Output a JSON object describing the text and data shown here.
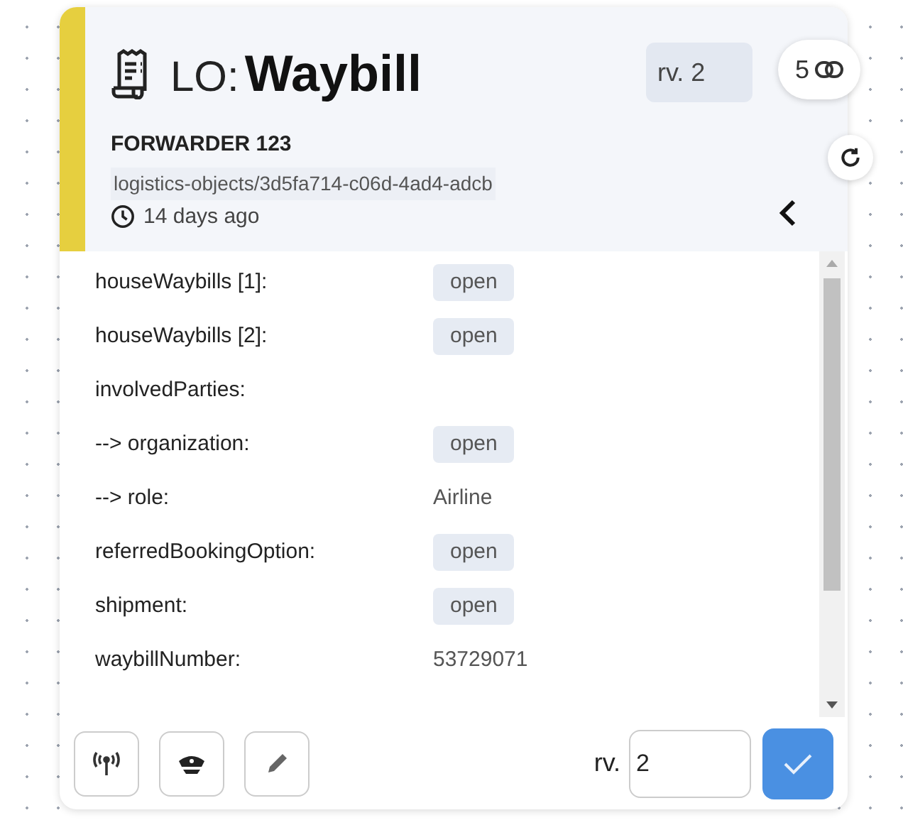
{
  "header": {
    "prefix": "LO:",
    "title": "Waybill",
    "revision_chip": "rv. 2",
    "link_count": "5",
    "owner": "FORWARDER 123",
    "path": "logistics-objects/3d5fa714-c06d-4ad4-adcb",
    "age": "14 days ago"
  },
  "properties": [
    {
      "kind": "link",
      "label": "houseWaybills [1]:",
      "value": "open"
    },
    {
      "kind": "link",
      "label": "houseWaybills [2]:",
      "value": "open"
    },
    {
      "kind": "heading",
      "label": "involvedParties:"
    },
    {
      "kind": "link",
      "label": "--> organization:",
      "value": "open"
    },
    {
      "kind": "text",
      "label": "--> role:",
      "value": "Airline"
    },
    {
      "kind": "link",
      "label": "referredBookingOption:",
      "value": "open"
    },
    {
      "kind": "link",
      "label": "shipment:",
      "value": "open"
    },
    {
      "kind": "text",
      "label": "waybillNumber:",
      "value": "53729071"
    }
  ],
  "footer": {
    "revision_label": "rv.",
    "revision_value": "2"
  }
}
